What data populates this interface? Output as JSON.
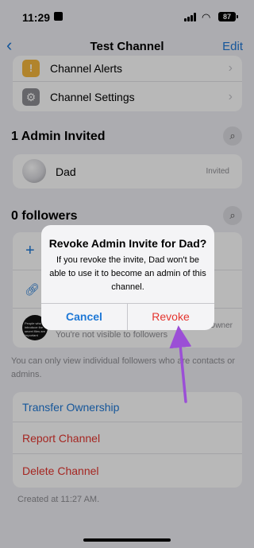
{
  "status": {
    "time": "11:29",
    "battery": "87"
  },
  "nav": {
    "back": "‹",
    "title": "Test Channel",
    "edit": "Edit"
  },
  "settings": [
    {
      "label": "Channel Alerts",
      "icon": "alert-icon",
      "color": "#f5b83d"
    },
    {
      "label": "Channel Settings",
      "icon": "gear-icon",
      "color": "#8e8e93"
    }
  ],
  "admins": {
    "title": "1 Admin Invited",
    "items": [
      {
        "name": "Dad",
        "status": "Invited"
      }
    ]
  },
  "followers": {
    "title": "0 followers",
    "owner_label": "Owner",
    "not_visible": "You're not visible to followers",
    "owner_avatar_text": "People who introduce the secret files are important"
  },
  "footer_note": "You can only view individual followers who are contacts or admins.",
  "actions": [
    {
      "label": "Transfer Ownership",
      "color": "#1e78d6"
    },
    {
      "label": "Report Channel",
      "color": "#e5352f"
    },
    {
      "label": "Delete Channel",
      "color": "#e5352f"
    }
  ],
  "created": "Created at 11:27 AM.",
  "alert": {
    "title": "Revoke Admin Invite for Dad?",
    "message": "If you revoke the invite, Dad won't be able to use it to become an admin of this channel.",
    "cancel": "Cancel",
    "revoke": "Revoke"
  }
}
